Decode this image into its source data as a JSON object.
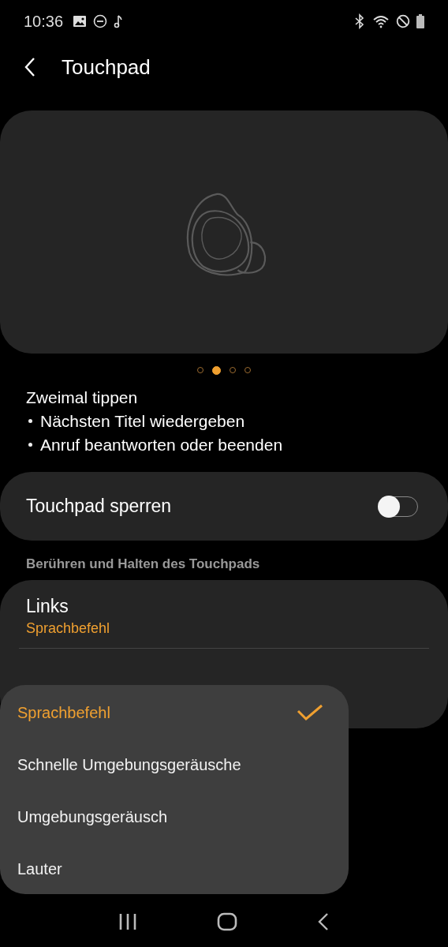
{
  "status_bar": {
    "time": "10:36"
  },
  "header": {
    "title": "Touchpad"
  },
  "illustration": {
    "pages": [
      {
        "selected": false
      },
      {
        "selected": true
      },
      {
        "selected": false
      },
      {
        "selected": false
      }
    ]
  },
  "description": {
    "heading": "Zweimal tippen",
    "bullets": [
      "Nächsten Titel wiedergeben",
      "Anruf beantworten oder beenden"
    ]
  },
  "lock": {
    "label": "Touchpad sperren",
    "on": false
  },
  "section": {
    "title": "Berühren und Halten des Touchpads"
  },
  "sides": [
    {
      "label": "Links",
      "value": "Sprachbefehl"
    }
  ],
  "menu": [
    {
      "label": "Sprachbefehl",
      "selected": true
    },
    {
      "label": "Schnelle Umgebungsgeräusche",
      "selected": false
    },
    {
      "label": "Umgebungsgeräusch",
      "selected": false
    },
    {
      "label": "Lauter",
      "selected": false
    }
  ]
}
